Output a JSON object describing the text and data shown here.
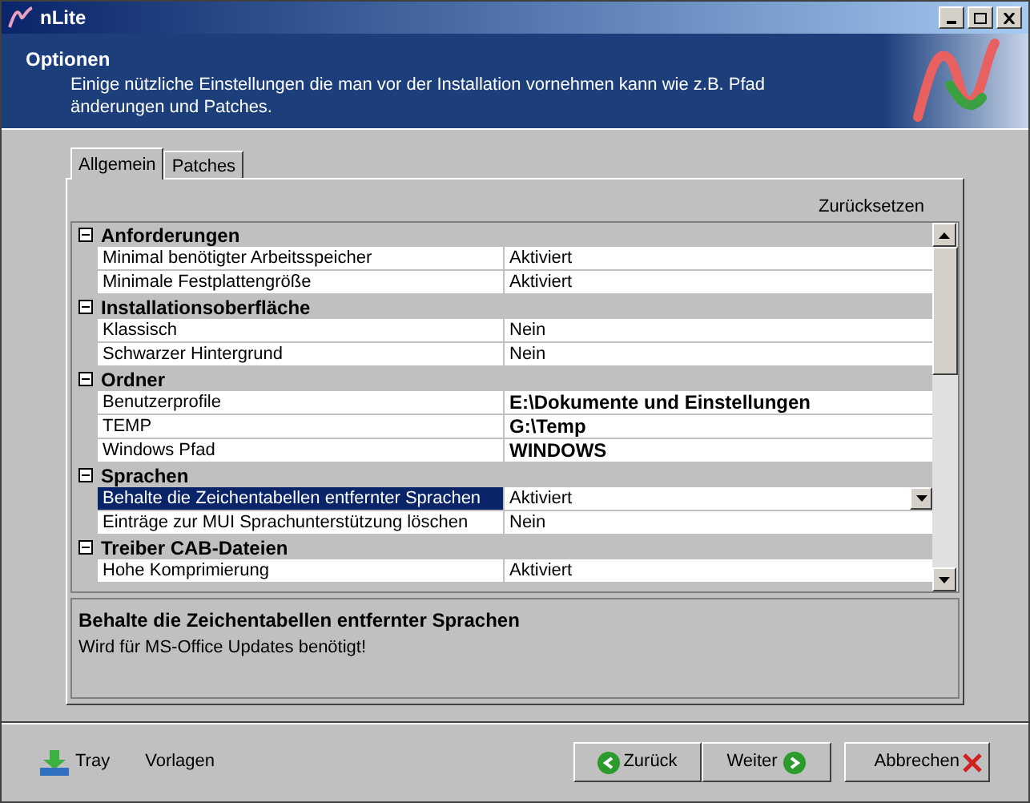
{
  "window": {
    "title": "nLite"
  },
  "header": {
    "title": "Optionen",
    "description": "Einige nützliche Einstellungen die man vor der Installation vornehmen kann wie z.B. Pfad änderungen und Patches."
  },
  "tabs": [
    {
      "label": "Allgemein",
      "selected": true
    },
    {
      "label": "Patches",
      "selected": false
    }
  ],
  "reset_link": "Zurücksetzen",
  "groups": [
    {
      "title": "Anforderungen",
      "expanded": true,
      "rows": [
        {
          "name": "Minimal benötigter Arbeitsspeicher",
          "value": "Aktiviert",
          "modified": false,
          "selected": false
        },
        {
          "name": "Minimale Festplattengröße",
          "value": "Aktiviert",
          "modified": false,
          "selected": false
        }
      ]
    },
    {
      "title": "Installationsoberfläche",
      "expanded": true,
      "rows": [
        {
          "name": "Klassisch",
          "value": "Nein",
          "modified": false,
          "selected": false
        },
        {
          "name": "Schwarzer Hintergrund",
          "value": "Nein",
          "modified": false,
          "selected": false
        }
      ]
    },
    {
      "title": "Ordner",
      "expanded": true,
      "rows": [
        {
          "name": "Benutzerprofile",
          "value": "E:\\Dokumente und Einstellungen",
          "modified": true,
          "selected": false
        },
        {
          "name": "TEMP",
          "value": "G:\\Temp",
          "modified": true,
          "selected": false
        },
        {
          "name": "Windows Pfad",
          "value": "WINDOWS",
          "modified": true,
          "selected": false
        }
      ]
    },
    {
      "title": "Sprachen",
      "expanded": true,
      "rows": [
        {
          "name": "Behalte die Zeichentabellen entfernter Sprachen",
          "value": "Aktiviert",
          "modified": false,
          "selected": true
        },
        {
          "name": "Einträge zur MUI Sprachunterstützung löschen",
          "value": "Nein",
          "modified": false,
          "selected": false
        }
      ]
    },
    {
      "title": "Treiber CAB-Dateien",
      "expanded": true,
      "rows": [
        {
          "name": "Hohe Komprimierung",
          "value": "Aktiviert",
          "modified": false,
          "selected": false
        }
      ]
    }
  ],
  "help": {
    "title": "Behalte die Zeichentabellen entfernter Sprachen",
    "text": "Wird für MS-Office Updates benötigt!"
  },
  "footer": {
    "tray": "Tray",
    "templates": "Vorlagen",
    "back": "Zurück",
    "next": "Weiter",
    "cancel": "Abbrechen"
  }
}
